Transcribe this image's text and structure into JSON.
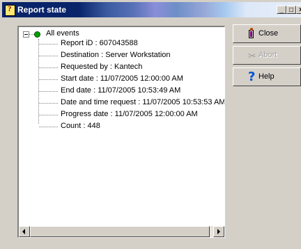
{
  "window": {
    "title": "Report state"
  },
  "title_buttons": {
    "minimize": "_",
    "maximize": "□",
    "close": "×"
  },
  "tree": {
    "root": {
      "label": "All events",
      "status_color": "#00a000"
    },
    "items": [
      "Report iD : 607043588",
      "Destination : Server Workstation",
      "Requested by : Kantech",
      "Start date : 11/07/2005 12:00:00 AM",
      "End date : 11/07/2005 10:53:49 AM",
      "Date and time request : 11/07/2005 10:53:53 AM",
      "Progress date : 11/07/2005 12:00:00 AM",
      "Count : 448"
    ]
  },
  "buttons": {
    "close": {
      "label": "Close",
      "icon": "exit-door-icon"
    },
    "abort": {
      "label": "Abort",
      "icon": "scissors-icon",
      "disabled": true
    },
    "help": {
      "label": "Help",
      "icon": "help-question-icon"
    }
  }
}
